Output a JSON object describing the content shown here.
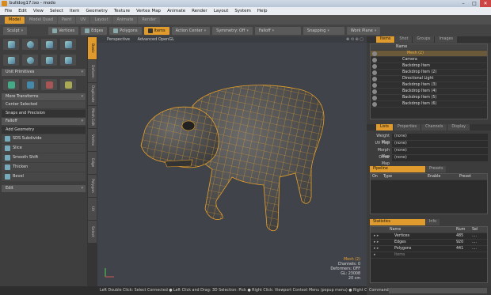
{
  "window": {
    "title": "bulldog17.lxo - modo"
  },
  "menu": [
    "File",
    "Edit",
    "View",
    "Select",
    "Item",
    "Geometry",
    "Texture",
    "Vertex Map",
    "Animate",
    "Render",
    "Layout",
    "System",
    "Help"
  ],
  "layout_tabs": [
    {
      "label": "Model",
      "active": true
    },
    {
      "label": "Model Quad",
      "active": false
    },
    {
      "label": "Paint",
      "active": false
    },
    {
      "label": "UV",
      "active": false
    },
    {
      "label": "Layout",
      "active": false
    },
    {
      "label": "Animate",
      "active": false
    },
    {
      "label": "Render",
      "active": false
    }
  ],
  "toolbar": {
    "sculpt": "Sculpt",
    "vertices": "Vertices",
    "edges": "Edges",
    "polygons": "Polygons",
    "items": "Items",
    "action_center": "Action Center",
    "symmetry": "Symmetry: Off",
    "falloff": "Falloff",
    "snapping": "Snapping",
    "work_plane": "Work Plane"
  },
  "left": {
    "unit_primitives": "Unit Primitives",
    "more_transforms": "More Transforms",
    "center_selected": "Center Selected",
    "snaps_precision": "Snaps and Precision",
    "falloff": "Falloff",
    "add_geometry": "Add Geometry",
    "tools": [
      "SDS Subdivide",
      "Slice",
      "Smooth Shift",
      "Thicken",
      "Bevel"
    ],
    "edit": "Edit"
  },
  "vtabs": [
    "Basic",
    "Deform",
    "Duplicate",
    "Mesh Edit",
    "Vertex",
    "Edge",
    "Polygon",
    "UV",
    "Select"
  ],
  "viewport": {
    "view": "Perspective",
    "shading": "Advanced OpenGL",
    "info": {
      "mesh": "Mesh (2)",
      "channels": "Channels: 0",
      "deformers": "Deformers: OFF",
      "gl": "GL: 23008",
      "distance": "20 cm"
    }
  },
  "right": {
    "tabs": [
      "Items",
      "Shot",
      "Groups",
      "Images"
    ],
    "items_header": "Name",
    "items": [
      {
        "name": "Mesh (2)",
        "sel": true
      },
      {
        "name": "Camera"
      },
      {
        "name": "Backdrop Item"
      },
      {
        "name": "Backdrop Item (2)"
      },
      {
        "name": "Directional Light"
      },
      {
        "name": "Backdrop Item (3)"
      },
      {
        "name": "Backdrop Item (4)"
      },
      {
        "name": "Backdrop Item (5)"
      },
      {
        "name": "Backdrop Item (6)"
      }
    ],
    "mid_tabs": [
      "Lists",
      "Properties",
      "Channels",
      "Display"
    ],
    "maps": [
      {
        "k": "Weight Map",
        "v": "(none)"
      },
      {
        "k": "UV Map",
        "v": "(none)"
      },
      {
        "k": "Morph Map",
        "v": "(none)"
      },
      {
        "k": "Other Map",
        "v": "(none)"
      }
    ],
    "pipeline_tabs": [
      "Pipeline",
      "Presets"
    ],
    "pipeline_cols": [
      "On",
      "Type",
      "Enable",
      "Preset"
    ],
    "stats_tabs": [
      "Statistics",
      "Info"
    ],
    "stats_cols": [
      "Name",
      "Num",
      "Sel"
    ],
    "stats": [
      {
        "name": "Vertices",
        "num": "485",
        "sel": "...."
      },
      {
        "name": "Edges",
        "num": "920",
        "sel": "...."
      },
      {
        "name": "Polygons",
        "num": "441",
        "sel": "...."
      },
      {
        "name": "Items",
        "num": "",
        "sel": ""
      }
    ]
  },
  "status": "Left Double Click: Select Connected ● Left Click and Drag: 3D Selection: Pick ● Right Click: Viewport Context Menu (popup menu) ● Right Cli...",
  "command_label": "Command"
}
